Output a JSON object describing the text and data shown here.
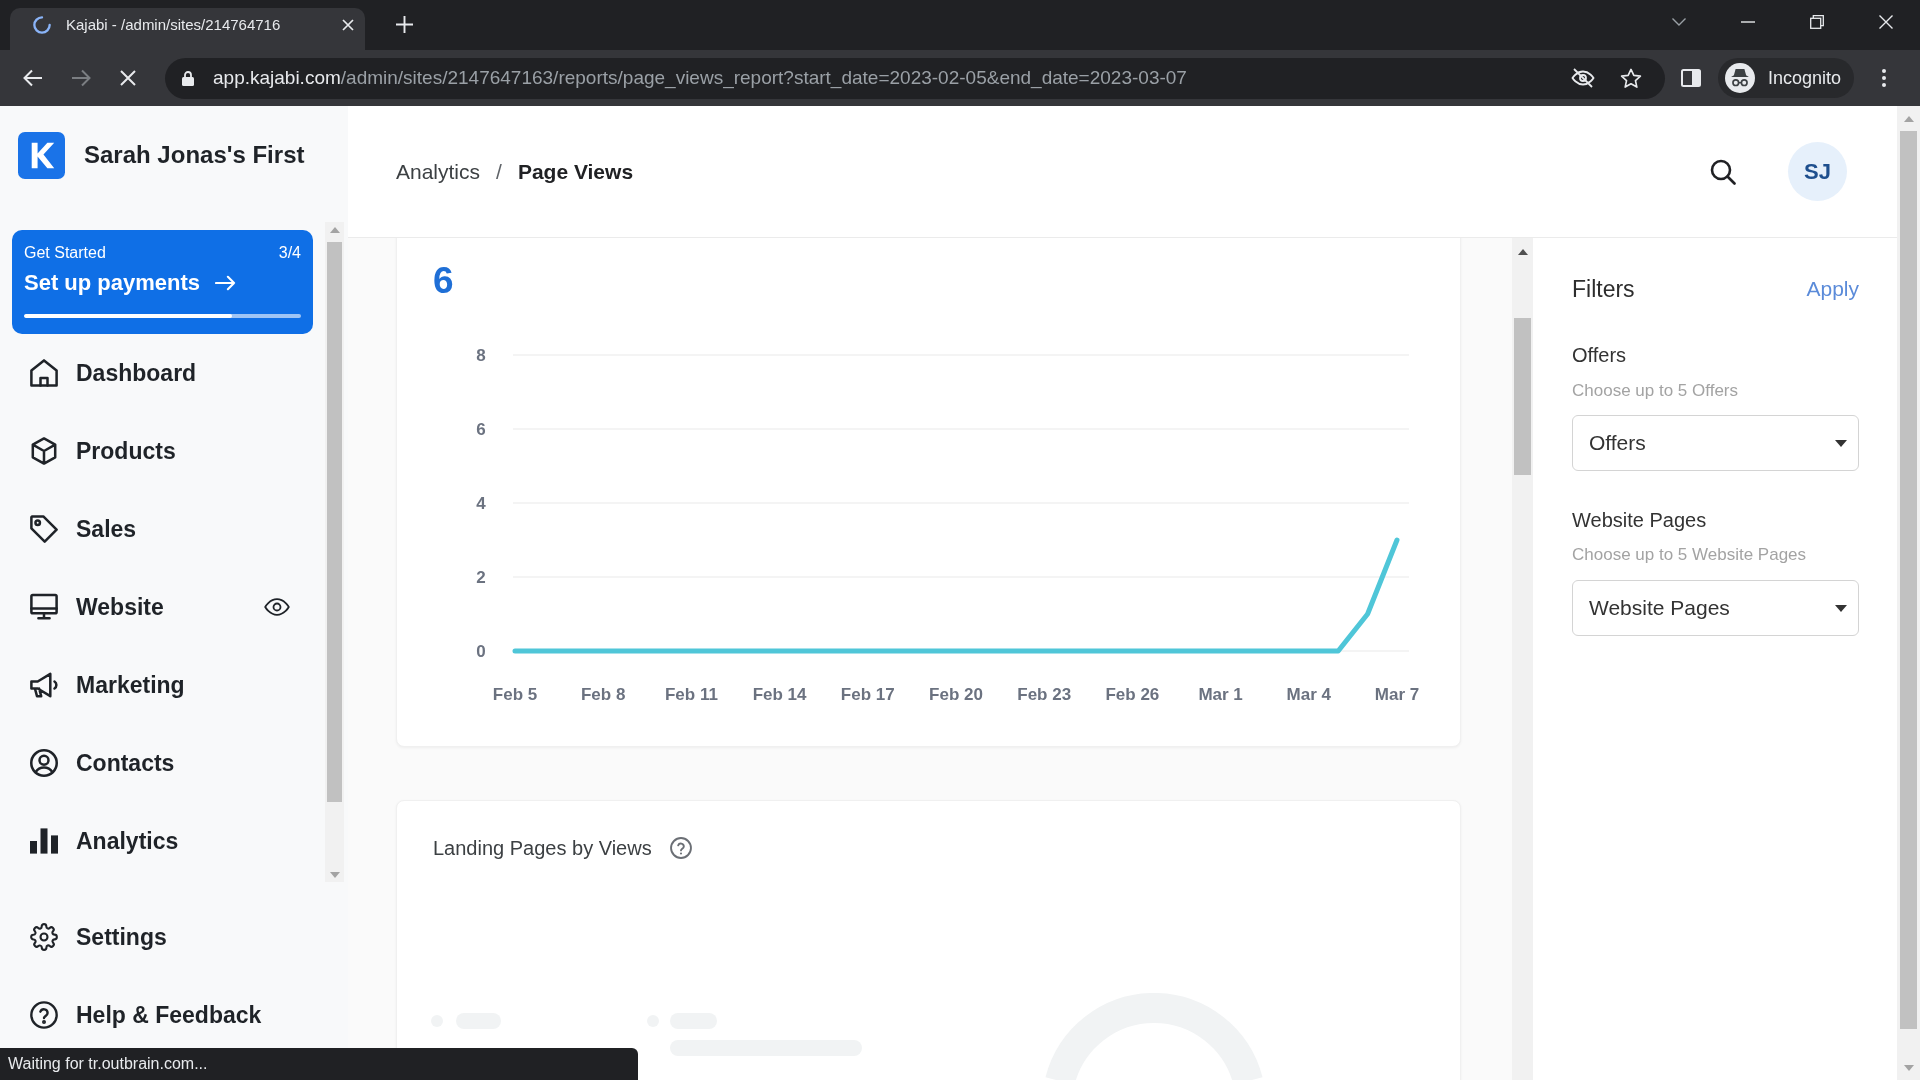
{
  "browser": {
    "tab": {
      "title": "Kajabi - /admin/sites/214764716",
      "loading": true
    },
    "address": {
      "host": "app.kajabi.com",
      "path": "/admin/sites/2147647163/reports/page_views_report?start_date=2023-02-05&end_date=2023-03-07"
    },
    "profile": "Incognito",
    "status_text": "Waiting for tr.outbrain.com..."
  },
  "sidebar": {
    "site_name": "Sarah Jonas's First",
    "get_started": {
      "label": "Get Started",
      "count": "3/4",
      "task": "Set up payments",
      "level": 0.75
    },
    "items": [
      {
        "label": "Dashboard",
        "preview": false
      },
      {
        "label": "Products",
        "preview": false
      },
      {
        "label": "Sales",
        "preview": false
      },
      {
        "label": "Website",
        "preview": true
      },
      {
        "label": "Marketing",
        "preview": false
      },
      {
        "label": "Contacts",
        "preview": false
      },
      {
        "label": "Analytics",
        "preview": false
      }
    ],
    "footer_items": [
      {
        "label": "Settings"
      },
      {
        "label": "Help & Feedback"
      }
    ]
  },
  "header": {
    "breadcrumb": [
      {
        "label": "Analytics"
      },
      {
        "label": "Page Views"
      }
    ],
    "separator": "/",
    "avatar_initials": "SJ"
  },
  "total_views": {
    "value": "6",
    "chart_data": {
      "type": "line",
      "categories": [
        "Feb 5",
        null,
        null,
        "Feb 8",
        null,
        null,
        "Feb 11",
        null,
        null,
        "Feb 14",
        null,
        null,
        "Feb 17",
        null,
        null,
        "Feb 20",
        null,
        null,
        "Feb 23",
        null,
        null,
        "Feb 26",
        null,
        null,
        "Mar 1",
        null,
        null,
        "Mar 4",
        null,
        null,
        "Mar 7"
      ],
      "series": [
        {
          "color": "#4fc6d8",
          "values": [
            0,
            0,
            0,
            0,
            0,
            0,
            0,
            0,
            0,
            0,
            0,
            0,
            0,
            0,
            0,
            0,
            0,
            0,
            0,
            0,
            0,
            0,
            0,
            0,
            0,
            0,
            0,
            0,
            0,
            1,
            3
          ]
        }
      ],
      "ylim": [
        0,
        8
      ],
      "yticks": [
        0,
        2,
        4,
        6,
        8
      ],
      "grid": true
    }
  },
  "landing_pages": {
    "title": "Landing Pages by Views",
    "loading": true
  },
  "filters": {
    "title": "Filters",
    "apply": "Apply",
    "groups": [
      {
        "label": "Offers",
        "hint": "Choose up to 5 Offers",
        "value": "Offers"
      },
      {
        "label": "Website Pages",
        "hint": "Choose up to 5 Website Pages",
        "value": "Website Pages"
      }
    ]
  }
}
